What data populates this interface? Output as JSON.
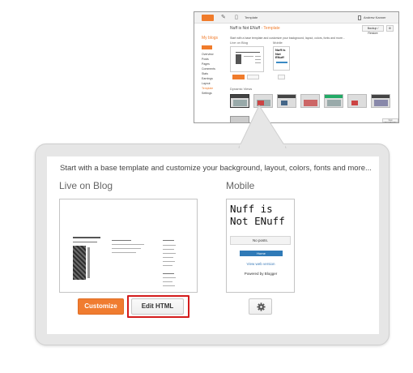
{
  "thumbnail": {
    "header": {
      "item_label": "Template",
      "user": "Andrew Kanner"
    },
    "sidebar": {
      "my_blogs": "My blogs",
      "items": [
        "Overview",
        "Posts",
        "Pages",
        "Comments",
        "Stats",
        "Earnings",
        "Layout",
        "Template",
        "Settings"
      ]
    },
    "breadcrumb": {
      "blog": "Nuff is Not ENuff",
      "page": "Template"
    },
    "backup_label": "Backup / Restore",
    "intro": "Start with a base template and customize your background, layout, colors, fonts and more...",
    "live_label": "Live on Blog",
    "mobile_label": "Mobile",
    "mobile_title": "Nuff is Not ENuff",
    "dynamic_views": "Dynamic Views",
    "footer_btn": "Got Feedback"
  },
  "template": {
    "intro": "Start with a base template and customize your background, layout, colors, fonts and more...",
    "live_label": "Live on Blog",
    "mobile_label": "Mobile",
    "customize_label": "Customize",
    "edit_html_label": "Edit HTML"
  },
  "mobile_preview": {
    "blog_title": "Nuff is Not ENuff",
    "no_posts": "No posts.",
    "home": "Home",
    "view_web": "View web version",
    "powered_by": "Powered by Blogger"
  },
  "colors": {
    "accent": "#f07c30",
    "highlight": "#d41c1c",
    "link": "#2f7ab7"
  },
  "icons": [
    "blogger-logo-icon",
    "pencil-icon",
    "page-icon",
    "gear-icon",
    "user-icon"
  ]
}
